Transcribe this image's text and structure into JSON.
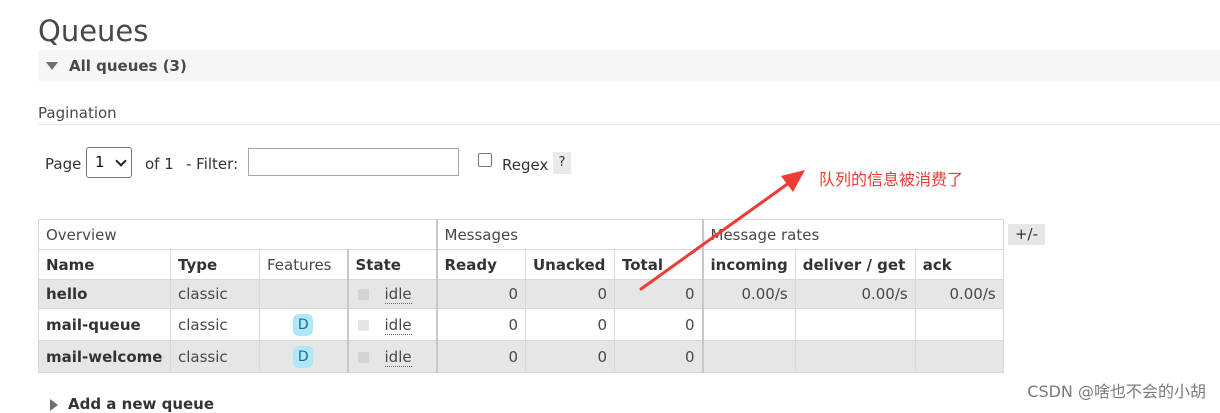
{
  "page": {
    "title": "Queues",
    "section_label": "All queues (3)",
    "pagination_label": "Pagination"
  },
  "pagination": {
    "page_label": "Page",
    "page_value": "1",
    "of_label": "of 1",
    "filter_label": "- Filter:",
    "filter_value": "",
    "regex_label": "Regex",
    "help_label": "?"
  },
  "table": {
    "groups": [
      "Overview",
      "Messages",
      "Message rates"
    ],
    "columns": [
      "Name",
      "Type",
      "Features",
      "State",
      "Ready",
      "Unacked",
      "Total",
      "incoming",
      "deliver / get",
      "ack"
    ],
    "toggle_label": "+/-",
    "rows": [
      {
        "name": "hello",
        "type": "classic",
        "feature": "",
        "state": "idle",
        "ready": "0",
        "unacked": "0",
        "total": "0",
        "incoming": "0.00/s",
        "deliver_get": "0.00/s",
        "ack": "0.00/s"
      },
      {
        "name": "mail-queue",
        "type": "classic",
        "feature": "D",
        "state": "idle",
        "ready": "0",
        "unacked": "0",
        "total": "0",
        "incoming": "",
        "deliver_get": "",
        "ack": ""
      },
      {
        "name": "mail-welcome",
        "type": "classic",
        "feature": "D",
        "state": "idle",
        "ready": "0",
        "unacked": "0",
        "total": "0",
        "incoming": "",
        "deliver_get": "",
        "ack": ""
      }
    ]
  },
  "add_queue_label": "Add a new queue",
  "annotation_text": "队列的信息被消费了",
  "watermark": "CSDN @啥也不会的小胡",
  "colors": {
    "annotation": "#ef3b36",
    "badge": "#aee7f7",
    "row_shade": "#e6e6e6"
  }
}
